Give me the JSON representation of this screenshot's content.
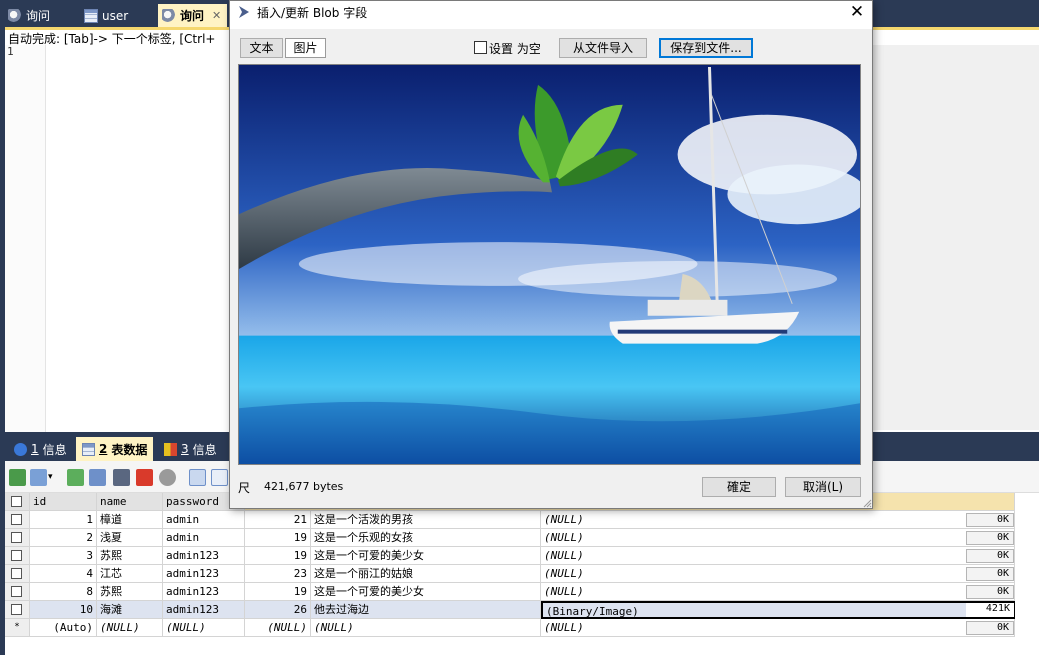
{
  "tabs": [
    {
      "label": "询问",
      "icon": "query-icon"
    },
    {
      "label": "user",
      "icon": "table-icon"
    },
    {
      "label": "询问",
      "icon": "query-icon",
      "active": true
    }
  ],
  "editor": {
    "autocomplete_hint": "自动完成: [Tab]-> 下一个标签, [Ctrl+",
    "line_number": "1"
  },
  "bottom_tabs": [
    {
      "num": "1",
      "label": "信息"
    },
    {
      "num": "2",
      "label": "表数据",
      "active": true
    },
    {
      "num": "3",
      "label": "信息"
    }
  ],
  "grid": {
    "headers": [
      "id",
      "name",
      "password"
    ],
    "rows": [
      {
        "id": "1",
        "name": "樟道",
        "password": "admin",
        "age": "21",
        "desc": "这是一个活泼的男孩",
        "blob": "(NULL)",
        "size": "0K"
      },
      {
        "id": "2",
        "name": "浅夏",
        "password": "admin",
        "age": "19",
        "desc": "这是一个乐观的女孩",
        "blob": "(NULL)",
        "size": "0K"
      },
      {
        "id": "3",
        "name": "苏熙",
        "password": "admin123",
        "age": "19",
        "desc": "这是一个可爱的美少女",
        "blob": "(NULL)",
        "size": "0K"
      },
      {
        "id": "4",
        "name": "江芯",
        "password": "admin123",
        "age": "23",
        "desc": "这是一个丽江的姑娘",
        "blob": "(NULL)",
        "size": "0K"
      },
      {
        "id": "8",
        "name": "苏熙",
        "password": "admin123",
        "age": "19",
        "desc": "这是一个可爱的美少女",
        "blob": "(NULL)",
        "size": "0K"
      },
      {
        "id": "10",
        "name": "海滩",
        "password": "admin123",
        "age": "26",
        "desc": "他去过海边",
        "blob": "(Binary/Image)",
        "size": "421K"
      }
    ],
    "new_row": {
      "marker": "*",
      "id": "(Auto)",
      "name": "(NULL)",
      "password": "(NULL)",
      "age": "(NULL)",
      "desc": "(NULL)",
      "blob": "(NULL)",
      "size": "0K"
    }
  },
  "dialog": {
    "title": "插入/更新 Blob 字段",
    "tab_text": "文本",
    "tab_image": "图片",
    "set_null_label": "设置 为空",
    "import_button": "从文件导入",
    "save_button": "保存到文件...",
    "size_label": "尺",
    "bytes": "421,677 bytes",
    "ok_button": "確定",
    "cancel_button": "取消(L)",
    "close_glyph": "✕"
  },
  "colors": {
    "chrome": "#2b3a55",
    "active_tab": "#fff3c4",
    "accent_focus": "#0078d7"
  }
}
